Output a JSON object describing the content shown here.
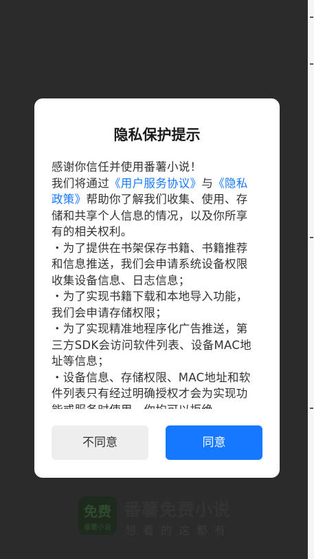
{
  "dialog": {
    "title": "隐私保护提示",
    "p1": "感谢你信任并使用番薯小说！",
    "p2_before": "我们将通过",
    "p2_link1": "《用户服务协议》",
    "p2_mid": "与",
    "p2_link2": "《隐私政策》",
    "p2_after": "帮助你了解我们收集、使用、存储和共享个人信息的情况，以及你所享有的相关权利。",
    "p3": "・为了提供在书架保存书籍、书籍推荐和信息推送，我们会申请系统设备权限收集设备信息、日志信息；",
    "p4": "・为了实现书籍下载和本地导入功能，我们会申请存储权限；",
    "p5": "・为了实现精准地程序化广告推送，第三方SDK会访问软件列表、设备MAC地址等信息；",
    "p6": "・设备信息、存储权限、MAC地址和软件列表只有经过明确授权才会为实现功能或服务时使用，你均可以拒绝。",
    "disagree_label": "不同意",
    "agree_label": "同意"
  },
  "brand": {
    "logo_text": "免费",
    "logo_sub": "番薯小说",
    "name": "番薯免费小说",
    "slogan": "想看的这都有"
  },
  "colors": {
    "accent": "#1677ff",
    "overlay": "#2b2b2b",
    "disagree_bg": "#eeeeee"
  }
}
